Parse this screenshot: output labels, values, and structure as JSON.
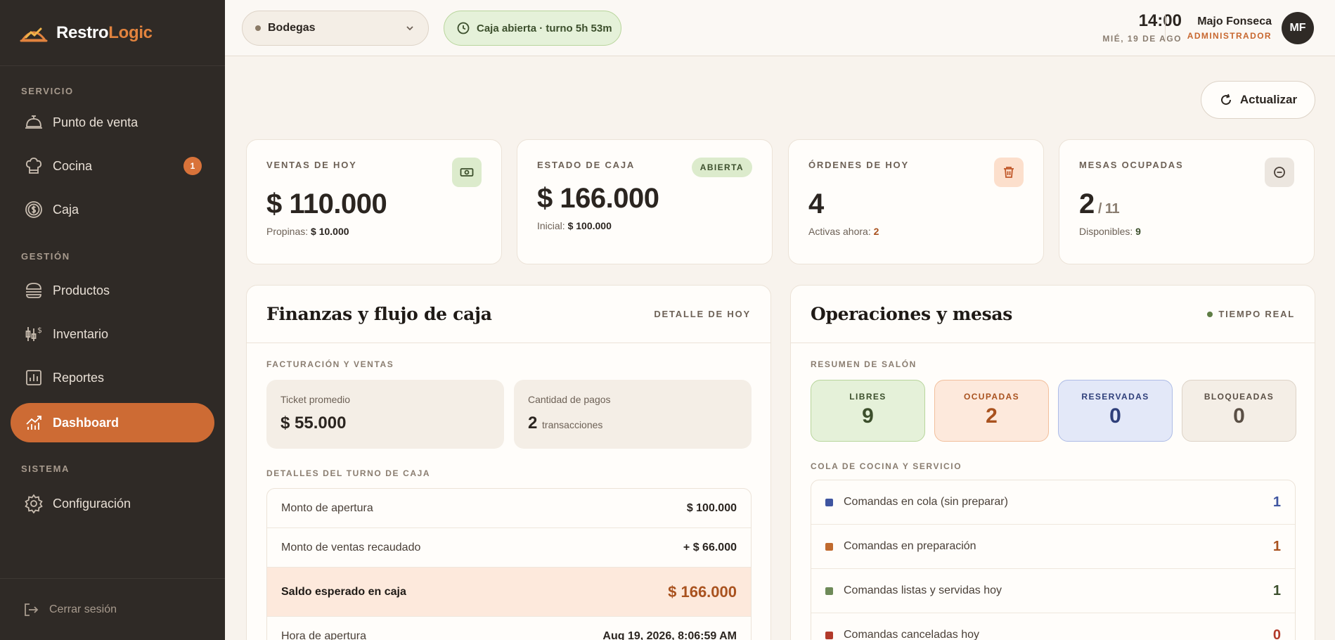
{
  "brand": {
    "name_a": "Restro",
    "name_b": "Logic"
  },
  "sidebar": {
    "sections": [
      {
        "title": "SERVICIO"
      },
      {
        "title": "GESTIÓN"
      },
      {
        "title": "SISTEMA"
      }
    ],
    "items": [
      {
        "label": "Punto de venta",
        "icon": "service-bell-icon"
      },
      {
        "label": "Cocina",
        "icon": "chef-hat-icon",
        "badge": "1"
      },
      {
        "label": "Caja",
        "icon": "coin-icon"
      },
      {
        "label": "Productos",
        "icon": "burger-icon"
      },
      {
        "label": "Inventario",
        "icon": "inventory-icon"
      },
      {
        "label": "Reportes",
        "icon": "bar-chart-icon"
      },
      {
        "label": "Dashboard",
        "icon": "dashboard-chart-icon",
        "active": true
      },
      {
        "label": "Configuración",
        "icon": "gear-icon"
      }
    ],
    "logout": "Cerrar sesión"
  },
  "topbar": {
    "branch": "Bodegas",
    "cash_status": "Caja abierta · turno 5h 53m",
    "time": "14:00",
    "date": "MIÉ, 19 DE AGO",
    "user_name": "Majo Fonseca",
    "user_role": "ADMINISTRADOR",
    "avatar_initials": "MF"
  },
  "main": {
    "refresh_label": "Actualizar",
    "kpis": [
      {
        "label": "VENTAS DE HOY",
        "value": "$ 110.000",
        "sub_label": "Propinas:",
        "sub_value": "$ 10.000"
      },
      {
        "label": "ESTADO DE CAJA",
        "tag": "ABIERTA",
        "value": "$ 166.000",
        "sub_label": "Inicial:",
        "sub_value": "$ 100.000"
      },
      {
        "label": "ÓRDENES DE HOY",
        "value": "4",
        "sub_label": "Activas ahora:",
        "sub_value": "2"
      },
      {
        "label": "MESAS OCUPADAS",
        "value": "2",
        "value_total": "/ 11",
        "sub_label": "Disponibles:",
        "sub_value": "9"
      }
    ],
    "finance": {
      "title": "Finanzas y flujo de caja",
      "header_right": "DETALLE DE HOY",
      "billing_title": "FACTURACIÓN Y VENTAS",
      "ticket_label": "Ticket promedio",
      "ticket_value": "$ 55.000",
      "payments_label": "Cantidad de pagos",
      "payments_value": "2",
      "payments_unit": "transacciones",
      "shift_title": "DETALLES DEL TURNO DE CAJA",
      "rows": [
        {
          "label": "Monto de apertura",
          "value": "$ 100.000"
        },
        {
          "label": "Monto de ventas recaudado",
          "value": "+ $ 66.000"
        },
        {
          "label": "Saldo esperado en caja",
          "value": "$ 166.000"
        },
        {
          "label": "Hora de apertura",
          "value": "Aug 19, 2026, 8:06:59 AM"
        }
      ]
    },
    "operations": {
      "title": "Operaciones y mesas",
      "header_right": "TIEMPO REAL",
      "salon_title": "RESUMEN DE SALÓN",
      "tiles": [
        {
          "label": "LIBRES",
          "value": "9"
        },
        {
          "label": "OCUPADAS",
          "value": "2"
        },
        {
          "label": "RESERVADAS",
          "value": "0"
        },
        {
          "label": "BLOQUEADAS",
          "value": "0"
        }
      ],
      "queue_title": "COLA DE COCINA Y SERVICIO",
      "queue": [
        {
          "label": "Comandas en cola (sin preparar)",
          "value": "1",
          "color": "#3f55a0"
        },
        {
          "label": "Comandas en preparación",
          "value": "1",
          "color": "#c06a2e"
        },
        {
          "label": "Comandas listas y servidas hoy",
          "value": "1",
          "color": "#6e8a58"
        },
        {
          "label": "Comandas canceladas hoy",
          "value": "0",
          "color": "#b23a2a"
        }
      ]
    }
  },
  "colors": {
    "accent": "#cd6b34",
    "sidebar_bg": "#2f2a26",
    "page_bg": "#f8f3ed"
  }
}
